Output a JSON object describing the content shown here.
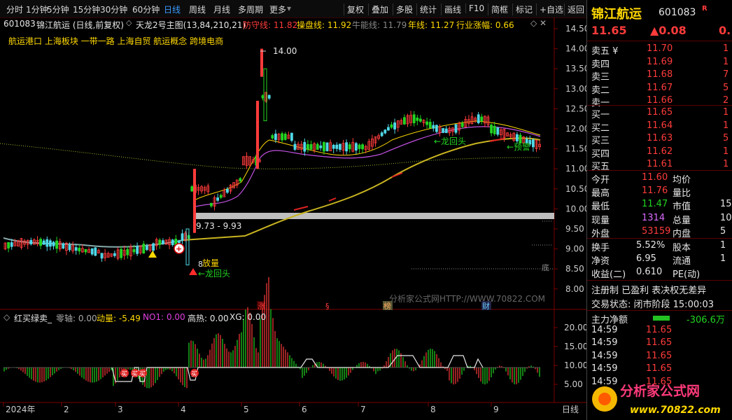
{
  "toolbar": {
    "left_items": [
      "分时",
      "1分钟",
      "5分钟",
      "15分钟",
      "30分钟",
      "60分钟",
      "日线",
      "周线",
      "月线",
      "多周期",
      "更多"
    ],
    "active": "日线",
    "right_items": [
      "复权",
      "叠加",
      "多股",
      "统计",
      "画线",
      "F10",
      "简框",
      "标记",
      "+自选",
      "返回"
    ]
  },
  "stock_header": {
    "code": "601083",
    "name_period": "锦江航运 (日线,前复权)",
    "indicator_name": "天龙2号主图(13,84,210,21)",
    "fangshou_label": "防守线:",
    "fangshou_value": "11.82",
    "caopan_label": "操盘线:",
    "caopan_value": "11.92",
    "niuneng_label": "牛能线:",
    "niuneng_value": "11.79",
    "nian_label": "年线:",
    "nian_value": "11.27",
    "hangye_label": "行业涨幅:",
    "hangye_value": "0.66",
    "concepts": "航运港口  上海板块  一带一路  上海自贸  航运概念  跨境电商"
  },
  "annotations": {
    "high_label": "14.00",
    "range_label": "9.73 - 9.93",
    "fangliang": "放量",
    "longhuitou_left": "←龙回头",
    "longhuitou_right1": "←龙回头",
    "longhuitou_right2": "←预警",
    "low_tag": "8",
    "watermark": "分析家公式网HTTP://WWW.70822.COM",
    "event_zhang": "涨",
    "event_s": "§",
    "event_bang": "榜",
    "event_cai": "财",
    "right_edge_small": "底"
  },
  "price_axis": [
    "14.50",
    "14.00",
    "13.50",
    "13.00",
    "12.50",
    "12.00",
    "11.50",
    "11.00",
    "10.50",
    "10.00",
    "9.50",
    "9.00",
    "8.50",
    "8.00"
  ],
  "sub_indicator": {
    "name": "红买绿卖_",
    "zero_label": "零轴:",
    "zero_value": "0.00",
    "dongliang_label": "动量:",
    "dongliang_value": "-5.49",
    "no1_label": "NO1:",
    "no1_value": "0.00",
    "gaore_label": "高热:",
    "gaore_value": "0.00",
    "xg_label": "XG:",
    "xg_value": "0.00",
    "axis": [
      "20.00",
      "15.00",
      "10.00",
      "5.00"
    ],
    "buy_tag": "买"
  },
  "date_axis": [
    "2024年",
    "2",
    "3",
    "4",
    "5",
    "6",
    "7",
    "8",
    "9"
  ],
  "period_label": "日线",
  "quote": {
    "name": "锦江航运",
    "code": "601083",
    "r_badge": "R",
    "price": "11.65",
    "change": "▲0.08",
    "change_pct": "0.",
    "asks": [
      {
        "label": "卖五 ¥",
        "price": "11.70",
        "vol": "1"
      },
      {
        "label": "卖四",
        "price": "11.69",
        "vol": "1"
      },
      {
        "label": "卖三",
        "price": "11.68",
        "vol": "7"
      },
      {
        "label": "卖二",
        "price": "11.67",
        "vol": "5"
      },
      {
        "label": "卖一",
        "price": "11.66",
        "vol": "2"
      }
    ],
    "bids": [
      {
        "label": "买一",
        "price": "11.65",
        "vol": "1"
      },
      {
        "label": "买二",
        "price": "11.64",
        "vol": "1"
      },
      {
        "label": "买三",
        "price": "11.63",
        "vol": "5"
      },
      {
        "label": "买四",
        "price": "11.62",
        "vol": "1"
      },
      {
        "label": "买五",
        "price": "11.61",
        "vol": "1"
      }
    ],
    "stats": [
      {
        "l1": "今开",
        "v1": "11.60",
        "l2": "均价",
        "v2": ""
      },
      {
        "l1": "最高",
        "v1": "11.76",
        "l2": "量比",
        "v2": ""
      },
      {
        "l1": "最低",
        "v1": "11.47",
        "l2": "市值",
        "v2": "15"
      },
      {
        "l1": "现量",
        "v1": "1314",
        "l2": "总量",
        "v2": "10"
      },
      {
        "l1": "外盘",
        "v1": "53159",
        "l2": "内盘",
        "v2": "5"
      }
    ],
    "stats2": [
      {
        "l1": "换手",
        "v1": "5.52%",
        "l2": "股本",
        "v2": "1"
      },
      {
        "l1": "净资",
        "v1": "6.95",
        "l2": "流通",
        "v2": "1"
      },
      {
        "l1": "收益(二)",
        "v1": "0.610",
        "l2": "PE(动)",
        "v2": ""
      }
    ],
    "flags": "注册制  已盈利  表决权无差异",
    "trade_status": "交易状态: 闭市阶段 15:00:03",
    "net_flow_label": "主力净额",
    "net_flow_value": "-306.6万",
    "ticks": [
      {
        "time": "14:59",
        "price": "11.65"
      },
      {
        "time": "14:59",
        "price": "11.65"
      },
      {
        "time": "14:59",
        "price": "11.65"
      },
      {
        "time": "14:59",
        "price": "11.65"
      },
      {
        "time": "14:59",
        "price": "11.65"
      }
    ]
  },
  "logo": {
    "site_name": "分析家公式网",
    "url": "www.70822.com"
  },
  "colors": {
    "up": "#ff3b3b",
    "down": "#22d422",
    "accent": "#3b9bff",
    "ma_yellow": "#ffd800",
    "ma_purple": "#d96bff"
  }
}
